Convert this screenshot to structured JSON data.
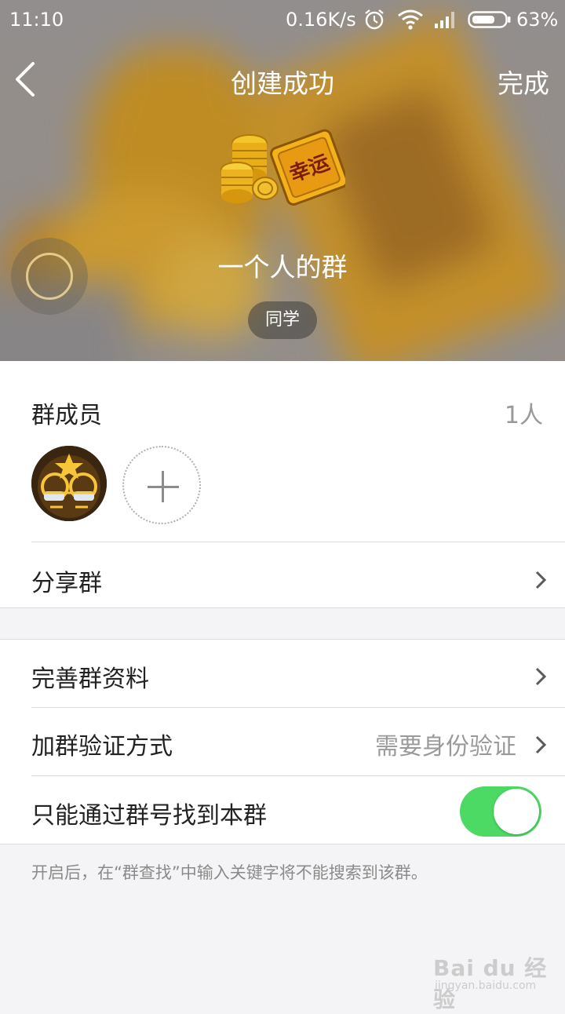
{
  "status_bar": {
    "time": "11:10",
    "net_speed": "0.16K/s",
    "battery": "63%",
    "icons": [
      "alarm-icon",
      "wifi-icon",
      "signal-icon",
      "battery-icon"
    ]
  },
  "nav": {
    "title": "创建成功",
    "done_label": "完成",
    "back_icon": "back-arrow-icon"
  },
  "group": {
    "name": "一个人的群",
    "tag": "同学",
    "avatar_text": "幸运"
  },
  "members": {
    "label": "群成员",
    "count": "1人"
  },
  "rows": {
    "share": "分享群",
    "complete_profile": "完善群资料",
    "verify_label": "加群验证方式",
    "verify_value": "需要身份验证",
    "search_only_label": "只能通过群号找到本群",
    "search_only_enabled": true
  },
  "footer_note": "开启后，在“群查找”中输入关键字将不能搜索到该群。",
  "watermark": {
    "main": "Bai du 经验",
    "sub": "jingyan.baidu.com"
  },
  "colors": {
    "toggle_on": "#4cd964",
    "background": "#f4f4f6"
  }
}
